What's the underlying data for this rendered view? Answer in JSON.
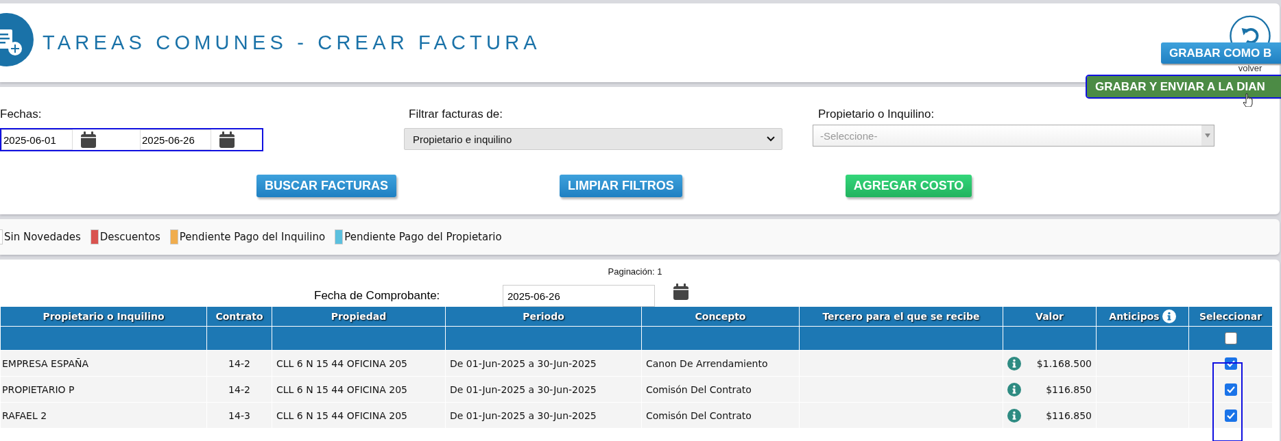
{
  "header": {
    "title": "TAREAS COMUNES - CREAR FACTURA",
    "back_label": "volver"
  },
  "actions": [
    {
      "label": "GRABAR COMO B",
      "kind": "blue",
      "focused": false
    },
    {
      "label": "GRABAR Y ENVIAR A LA DIAN",
      "kind": "green",
      "focused": true
    }
  ],
  "filters": {
    "dates": {
      "label": "Fechas:",
      "from": "2025-06-01",
      "to": "2025-06-26",
      "focused": true
    },
    "filter_by": {
      "label": "Filtrar facturas de:",
      "value": "Propietario e inquilino"
    },
    "party": {
      "label": "Propietario o Inquilino:",
      "placeholder": "-Seleccione-"
    },
    "buttons": [
      {
        "label": "BUSCAR FACTURAS",
        "kind": "primary"
      },
      {
        "label": "LIMPIAR FILTROS",
        "kind": "primary"
      },
      {
        "label": "AGREGAR COSTO",
        "kind": "success"
      }
    ]
  },
  "legend": [
    {
      "label": "Sin Novedades",
      "color": "#ffffff"
    },
    {
      "label": "Descuentos",
      "color": "#d9534f"
    },
    {
      "label": "Pendiente Pago del Inquilino",
      "color": "#f0ad4e"
    },
    {
      "label": "Pendiente Pago del Propietario",
      "color": "#5bc0de"
    }
  ],
  "table": {
    "pagination": "Paginación: 1",
    "voucher_date": {
      "label": "Fecha de Comprobante:",
      "value": "2025-06-26"
    },
    "columns": [
      {
        "label": "Propietario o Inquilino",
        "info": false
      },
      {
        "label": "Contrato",
        "info": false
      },
      {
        "label": "Propiedad",
        "info": false
      },
      {
        "label": "Periodo",
        "info": false
      },
      {
        "label": "Concepto",
        "info": false
      },
      {
        "label": "Tercero para el que se recibe",
        "info": false
      },
      {
        "label": "Valor",
        "info": false
      },
      {
        "label": "Anticipos",
        "info": true
      },
      {
        "label": "Seleccionar",
        "info": false
      }
    ],
    "select_all": {
      "checked": false
    },
    "select_outlined": true,
    "rows": [
      {
        "owner": "EMPRESA ESPAÑA",
        "contract": "14-2",
        "property": "CLL 6 N 15 44 OFICINA 205",
        "period": "De 01-Jun-2025 a 30-Jun-2025",
        "concept": "Canon De Arrendamiento",
        "value": "$1.168.500",
        "checked": true
      },
      {
        "owner": "PROPIETARIO P",
        "contract": "14-2",
        "property": "CLL 6 N 15 44 OFICINA 205",
        "period": "De 01-Jun-2025 a 30-Jun-2025",
        "concept": "Comisón Del Contrato",
        "value": "$116.850",
        "checked": true
      },
      {
        "owner": "RAFAEL 2",
        "contract": "14-3",
        "property": "CLL 6 N 15 44 OFICINA 205",
        "period": "De 01-Jun-2025 a 30-Jun-2025",
        "concept": "Comisón Del Contrato",
        "value": "$116.850",
        "checked": true
      }
    ]
  }
}
